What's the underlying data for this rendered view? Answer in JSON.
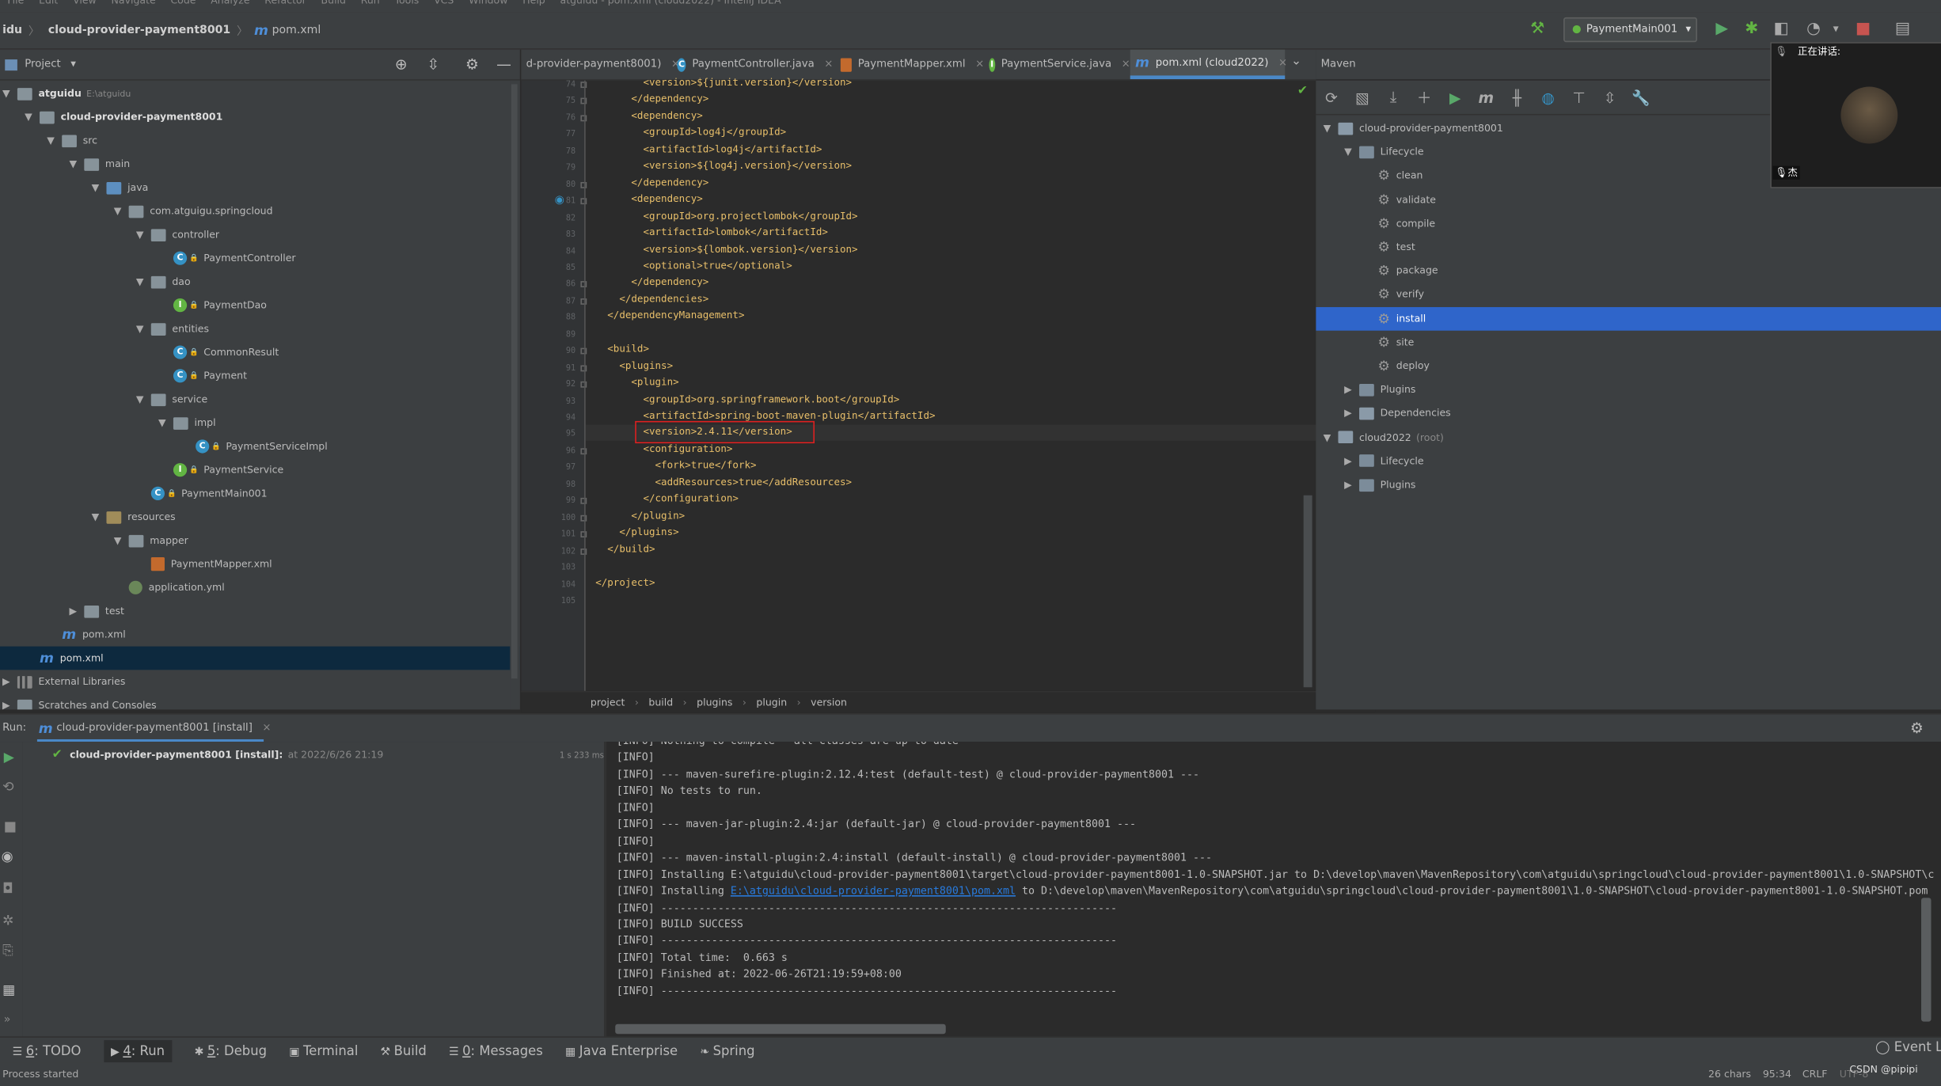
{
  "menubar": [
    "File",
    "Edit",
    "View",
    "Navigate",
    "Code",
    "Analyze",
    "Refactor",
    "Build",
    "Run",
    "Tools",
    "VCS",
    "Window",
    "Help",
    "atguidu - pom.xml (cloud2022) - IntelliJ IDEA"
  ],
  "navbar": {
    "root": "idu",
    "module": "cloud-provider-payment8001",
    "file": "pom.xml"
  },
  "run_config": {
    "label": "PaymentMain001"
  },
  "project_panel": {
    "title": "Project"
  },
  "tree": [
    {
      "label": "atguidu",
      "suffix": "E:\\atguidu",
      "indent": 0,
      "icon": "folder",
      "expanded": true
    },
    {
      "label": "cloud-provider-payment8001",
      "indent": 1,
      "icon": "folder",
      "expanded": true,
      "bold": true
    },
    {
      "label": "src",
      "indent": 2,
      "icon": "folder",
      "expanded": true
    },
    {
      "label": "main",
      "indent": 3,
      "icon": "folder",
      "expanded": true
    },
    {
      "label": "java",
      "indent": 4,
      "icon": "srcfolder",
      "expanded": true
    },
    {
      "label": "com.atguigu.springcloud",
      "indent": 5,
      "icon": "folder",
      "expanded": true
    },
    {
      "label": "controller",
      "indent": 6,
      "icon": "folder",
      "expanded": true
    },
    {
      "label": "PaymentController",
      "indent": 7,
      "icon": "class"
    },
    {
      "label": "dao",
      "indent": 6,
      "icon": "folder",
      "expanded": true
    },
    {
      "label": "PaymentDao",
      "indent": 7,
      "icon": "interface"
    },
    {
      "label": "entities",
      "indent": 6,
      "icon": "folder",
      "expanded": true
    },
    {
      "label": "CommonResult",
      "indent": 7,
      "icon": "class"
    },
    {
      "label": "Payment",
      "indent": 7,
      "icon": "class"
    },
    {
      "label": "service",
      "indent": 6,
      "icon": "folder",
      "expanded": true
    },
    {
      "label": "impl",
      "indent": 7,
      "icon": "folder",
      "expanded": true
    },
    {
      "label": "PaymentServiceImpl",
      "indent": 8,
      "icon": "class"
    },
    {
      "label": "PaymentService",
      "indent": 7,
      "icon": "interface"
    },
    {
      "label": "PaymentMain001",
      "indent": 6,
      "icon": "class"
    },
    {
      "label": "resources",
      "indent": 4,
      "icon": "resfolder",
      "expanded": true
    },
    {
      "label": "mapper",
      "indent": 5,
      "icon": "folder",
      "expanded": true
    },
    {
      "label": "PaymentMapper.xml",
      "indent": 6,
      "icon": "xml"
    },
    {
      "label": "application.yml",
      "indent": 5,
      "icon": "yml"
    },
    {
      "label": "test",
      "indent": 3,
      "icon": "folder",
      "expanded": false
    },
    {
      "label": "pom.xml",
      "indent": 2,
      "icon": "maven"
    },
    {
      "label": "pom.xml",
      "indent": 1,
      "icon": "maven",
      "selected": true
    },
    {
      "label": "External Libraries",
      "indent": 0,
      "icon": "lib",
      "expanded": false
    },
    {
      "label": "Scratches and Consoles",
      "indent": 0,
      "icon": "folder",
      "expanded": false
    }
  ],
  "tabs": [
    {
      "label": "d-provider-payment8001)",
      "icon": "none"
    },
    {
      "label": "PaymentController.java",
      "icon": "class"
    },
    {
      "label": "PaymentMapper.xml",
      "icon": "xml"
    },
    {
      "label": "PaymentService.java",
      "icon": "interface"
    },
    {
      "label": "pom.xml (cloud2022)",
      "icon": "maven",
      "active": true
    }
  ],
  "editor": {
    "lines": [
      {
        "n": "74",
        "text": "        <version>${junit.version}</version>"
      },
      {
        "n": "75",
        "text": "      </dependency>"
      },
      {
        "n": "76",
        "text": "      <dependency>"
      },
      {
        "n": "77",
        "text": "        <groupId>log4j</groupId>"
      },
      {
        "n": "78",
        "text": "        <artifactId>log4j</artifactId>"
      },
      {
        "n": "79",
        "text": "        <version>${log4j.version}</version>"
      },
      {
        "n": "80",
        "text": "      </dependency>"
      },
      {
        "n": "81",
        "text": "      <dependency>"
      },
      {
        "n": "82",
        "text": "        <groupId>org.projectlombok</groupId>"
      },
      {
        "n": "83",
        "text": "        <artifactId>lombok</artifactId>"
      },
      {
        "n": "84",
        "text": "        <version>${lombok.version}</version>"
      },
      {
        "n": "85",
        "text": "        <optional>true</optional>"
      },
      {
        "n": "86",
        "text": "      </dependency>"
      },
      {
        "n": "87",
        "text": "    </dependencies>"
      },
      {
        "n": "88",
        "text": "  </dependencyManagement>"
      },
      {
        "n": "89",
        "text": ""
      },
      {
        "n": "90",
        "text": "  <build>"
      },
      {
        "n": "91",
        "text": "    <plugins>"
      },
      {
        "n": "92",
        "text": "      <plugin>"
      },
      {
        "n": "93",
        "text": "        <groupId>org.springframework.boot</groupId>"
      },
      {
        "n": "94",
        "text": "        <artifactId>spring-boot-maven-plugin</artifactId>"
      },
      {
        "n": "95",
        "text": "        <version>2.4.11</version>"
      },
      {
        "n": "96",
        "text": "        <configuration>"
      },
      {
        "n": "97",
        "text": "          <fork>true</fork>"
      },
      {
        "n": "98",
        "text": "          <addResources>true</addResources>"
      },
      {
        "n": "99",
        "text": "        </configuration>"
      },
      {
        "n": "100",
        "text": "      </plugin>"
      },
      {
        "n": "101",
        "text": "    </plugins>"
      },
      {
        "n": "102",
        "text": "  </build>"
      },
      {
        "n": "103",
        "text": ""
      },
      {
        "n": "104",
        "text": "</project>"
      },
      {
        "n": "105",
        "text": ""
      }
    ],
    "breadcrumbs": [
      "project",
      "build",
      "plugins",
      "plugin",
      "version"
    ]
  },
  "maven": {
    "title": "Maven",
    "tree": [
      {
        "label": "cloud-provider-payment8001",
        "indent": 0,
        "icon": "module",
        "expanded": true
      },
      {
        "label": "Lifecycle",
        "indent": 1,
        "icon": "folder",
        "expanded": true
      },
      {
        "label": "clean",
        "indent": 2,
        "icon": "gear"
      },
      {
        "label": "validate",
        "indent": 2,
        "icon": "gear"
      },
      {
        "label": "compile",
        "indent": 2,
        "icon": "gear"
      },
      {
        "label": "test",
        "indent": 2,
        "icon": "gear"
      },
      {
        "label": "package",
        "indent": 2,
        "icon": "gear"
      },
      {
        "label": "verify",
        "indent": 2,
        "icon": "gear"
      },
      {
        "label": "install",
        "indent": 2,
        "icon": "gear",
        "selected": true
      },
      {
        "label": "site",
        "indent": 2,
        "icon": "gear"
      },
      {
        "label": "deploy",
        "indent": 2,
        "icon": "gear"
      },
      {
        "label": "Plugins",
        "indent": 1,
        "icon": "folder",
        "expanded": false
      },
      {
        "label": "Dependencies",
        "indent": 1,
        "icon": "lib",
        "expanded": false
      },
      {
        "label": "cloud2022",
        "suffix": "(root)",
        "indent": 0,
        "icon": "module",
        "expanded": true
      },
      {
        "label": "Lifecycle",
        "indent": 1,
        "icon": "folder",
        "expanded": false
      },
      {
        "label": "Plugins",
        "indent": 1,
        "icon": "folder",
        "expanded": false
      }
    ]
  },
  "video": {
    "status": "正在讲话:",
    "name": "杰"
  },
  "run": {
    "label": "Run:",
    "tab": "cloud-provider-payment8001 [install]",
    "task": "cloud-provider-payment8001 [install]:",
    "task_time": "at 2022/6/26 21:19",
    "duration": "1 s 233 ms"
  },
  "console": [
    "[INFO] Nothing to compile - all classes are up to date",
    "[INFO]",
    "[INFO] --- maven-surefire-plugin:2.12.4:test (default-test) @ cloud-provider-payment8001 ---",
    "[INFO] No tests to run.",
    "[INFO]",
    "[INFO] --- maven-jar-plugin:2.4:jar (default-jar) @ cloud-provider-payment8001 ---",
    "[INFO]",
    "[INFO] --- maven-install-plugin:2.4:install (default-install) @ cloud-provider-payment8001 ---",
    "[INFO] Installing E:\\atguidu\\cloud-provider-payment8001\\target\\cloud-provider-payment8001-1.0-SNAPSHOT.jar to D:\\develop\\maven\\MavenRepository\\com\\atguidu\\springcloud\\cloud-provider-payment8001\\1.0-SNAPSHOT\\c",
    "__LINKLINE__",
    "[INFO] ------------------------------------------------------------------------",
    "[INFO] BUILD SUCCESS",
    "[INFO] ------------------------------------------------------------------------",
    "[INFO] Total time:  0.663 s",
    "[INFO] Finished at: 2022-06-26T21:19:59+08:00",
    "[INFO] ------------------------------------------------------------------------"
  ],
  "console_link": {
    "prefix": "[INFO] Installing ",
    "link": "E:\\atguidu\\cloud-provider-payment8001\\pom.xml",
    "suffix": " to D:\\develop\\maven\\MavenRepository\\com\\atguidu\\springcloud\\cloud-provider-payment8001\\1.0-SNAPSHOT\\cloud-provider-payment8001-1.0-SNAPSHOT.pom"
  },
  "bottom_tabs": [
    {
      "key": "6",
      "label": ": TODO",
      "icon": "☰"
    },
    {
      "key": "4",
      "label": ": Run",
      "icon": "▶",
      "active": true
    },
    {
      "key": "5",
      "label": ": Debug",
      "icon": "✱"
    },
    {
      "key": "",
      "label": "Terminal",
      "icon": "▣"
    },
    {
      "key": "",
      "label": "Build",
      "icon": "⚒"
    },
    {
      "key": "0",
      "label": ": Messages",
      "icon": "☰"
    },
    {
      "key": "",
      "label": "Java Enterprise",
      "icon": "▦"
    },
    {
      "key": "",
      "label": "Spring",
      "icon": "❧"
    }
  ],
  "event_log": "Event L",
  "status": {
    "left": "Process started",
    "chars": "26 chars",
    "pos": "95:34",
    "eol": "CRLF",
    "enc": "UTF-8",
    "watermark": "CSDN @pipipi"
  }
}
